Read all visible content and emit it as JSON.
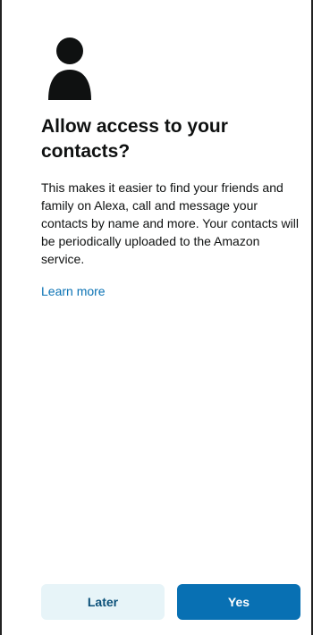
{
  "dialog": {
    "title": "Allow access to your contacts?",
    "body": "This makes it easier to find your friends and family on Alexa, call and message your contacts by name and more. Your contacts will be periodically uploaded to the Amazon service.",
    "learn_more_label": "Learn more",
    "icon": "person-icon"
  },
  "actions": {
    "later_label": "Later",
    "yes_label": "Yes"
  },
  "colors": {
    "accent": "#0870b3",
    "link": "#0a72b4",
    "secondary_button_bg": "#e7f4f8",
    "text": "#0f1111"
  }
}
